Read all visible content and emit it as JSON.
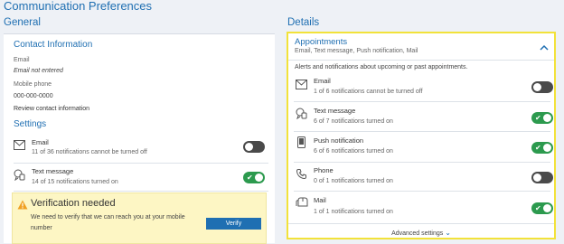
{
  "page": {
    "title": "Communication Preferences"
  },
  "general": {
    "heading": "General",
    "contact": {
      "title": "Contact Information",
      "email_label": "Email",
      "email_value": "Email not entered",
      "phone_label": "Mobile phone",
      "phone_value": "000-000-0000",
      "review_link": "Review contact information"
    },
    "settings": {
      "title": "Settings",
      "rows": [
        {
          "name": "Email",
          "status": "11 of 36 notifications cannot be turned off",
          "enabled": false
        },
        {
          "name": "Text message",
          "status": "14 of 15 notifications turned on",
          "enabled": true
        }
      ]
    },
    "verification": {
      "title": "Verification needed",
      "message": "We need to verify that we can reach you at your mobile number",
      "button": "Verify"
    }
  },
  "details": {
    "heading": "Details",
    "appointments": {
      "title": "Appointments",
      "channels_summary": "Email, Text message, Push notification, Mail",
      "description": "Alerts and notifications about upcoming or past appointments.",
      "rows": [
        {
          "name": "Email",
          "status": "1 of 6 notifications cannot be turned off",
          "enabled": false
        },
        {
          "name": "Text message",
          "status": "6 of 7 notifications turned on",
          "enabled": true
        },
        {
          "name": "Push notification",
          "status": "6 of 6 notifications turned on",
          "enabled": true
        },
        {
          "name": "Phone",
          "status": "0 of 1 notifications turned on",
          "enabled": false
        },
        {
          "name": "Mail",
          "status": "1 of 1 notifications turned on",
          "enabled": true
        }
      ],
      "advanced_link": "Advanced settings"
    }
  },
  "colors": {
    "accent": "#1f6fb2",
    "toggle_on": "#2c9a4e",
    "toggle_off": "#4a4a4a",
    "highlight": "#f2e23a",
    "warning_bg": "#fdf6c4"
  },
  "icons": [
    "envelope-icon",
    "chat-phone-icon",
    "mobile-device-icon",
    "phone-icon",
    "mailbox-icon",
    "warning-icon",
    "chevron-up-icon",
    "chevron-down-icon"
  ]
}
